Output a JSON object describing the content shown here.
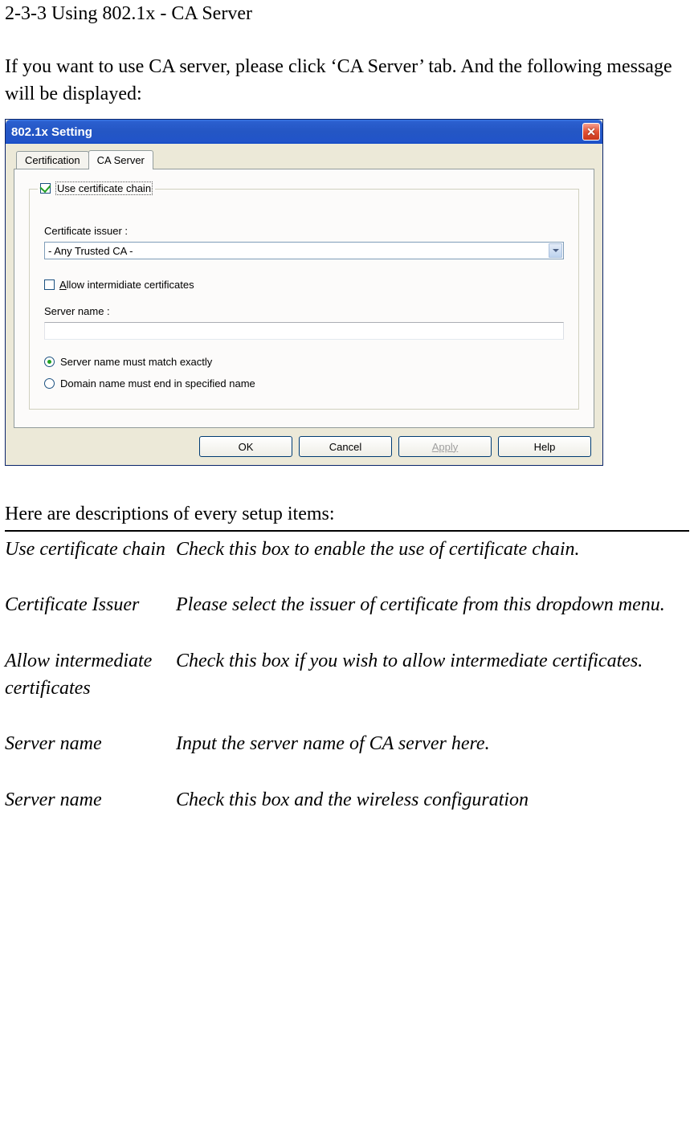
{
  "heading": "2-3-3 Using 802.1x - CA Server",
  "intro": "If you want to use CA server, please click ‘CA Server’ tab. And the following message will be displayed:",
  "window": {
    "title": "802.1x Setting",
    "tabs": {
      "certification": "Certification",
      "ca_server": "CA Server"
    },
    "use_cert_chain_label": "Use certificate chain",
    "cert_issuer_label": "Certificate issuer :",
    "issuer_value": "- Any Trusted CA -",
    "allow_intermediate_pre": "A",
    "allow_intermediate_rest": "llow intermidiate certificates",
    "server_name_label": "Server name :",
    "server_name_value": "",
    "radio_match_exactly": "Server name must match exactly",
    "radio_domain_end": "Domain name must end in specified name",
    "buttons": {
      "ok": "OK",
      "cancel": "Cancel",
      "apply": "Apply",
      "help": "Help"
    }
  },
  "below_intro": "Here are descriptions of every setup items:",
  "descriptions": {
    "use_cert_chain": {
      "label": "Use certificate chain",
      "text": "Check this box to enable the use of certificate chain."
    },
    "cert_issuer": {
      "label": "Certificate Issuer",
      "text": "Please select the issuer of certificate from this dropdown menu."
    },
    "allow_intermediate": {
      "label": "Allow intermediate certificates",
      "text": "Check this box if you wish to allow intermediate certificates."
    },
    "server_name": {
      "label": "Server name",
      "text": "Input the server name of CA server here."
    },
    "server_name2": {
      "label": "Server name",
      "text": "Check this box and the wireless configuration"
    }
  }
}
